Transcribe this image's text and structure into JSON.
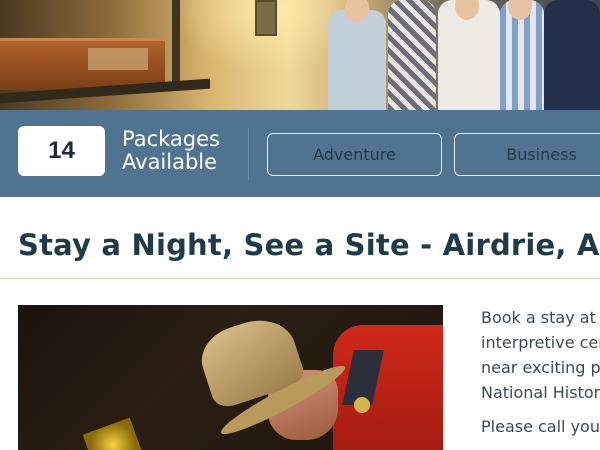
{
  "filter_bar": {
    "package_count": "14",
    "count_label_line1": "Packages",
    "count_label_line2": "Available",
    "categories": [
      "Adventure",
      "Business"
    ]
  },
  "article": {
    "title": "Stay a Night, See a Site - Airdrie, AB",
    "paragraph1_lines": [
      "Book a stay at t",
      "interpretive cen",
      "near exciting p",
      "National Histor"
    ],
    "paragraph2_line1": "Please call you"
  },
  "colors": {
    "filter_bar_bg": "#4f7390",
    "title_color": "#1f3a4a",
    "body_text": "#3b4954"
  }
}
